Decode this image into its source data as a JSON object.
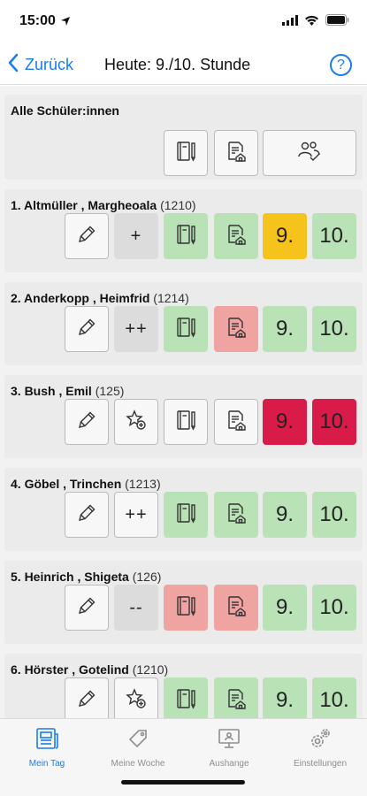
{
  "status_bar": {
    "time": "15:00"
  },
  "nav": {
    "back_label": "Zurück",
    "title": "Heute: 9./10. Stunde",
    "help_label": "?"
  },
  "all_students": {
    "label": "Alle Schüler:innen"
  },
  "students": [
    {
      "label": "1. Altmüller  , Margheoala",
      "id": "(1210)",
      "rating": "+",
      "tiles": {
        "action": "grey",
        "notebook": "green",
        "homework": "green",
        "h9": "yellow",
        "h10": "green"
      },
      "hour9": "9.",
      "hour10": "10."
    },
    {
      "label": "2. Anderkopp  , Heimfrid",
      "id": "(1214)",
      "rating": "++",
      "tiles": {
        "action": "grey",
        "notebook": "green",
        "homework": "red",
        "h9": "green",
        "h10": "green"
      },
      "hour9": "9.",
      "hour10": "10."
    },
    {
      "label": "3. Bush  , Emil",
      "id": "(125)",
      "rating": "star-add",
      "tiles": {
        "action": "plain",
        "notebook": "plain",
        "homework": "plain",
        "h9": "crimson",
        "h10": "crimson"
      },
      "hour9": "9.",
      "hour10": "10."
    },
    {
      "label": "4. Göbel  , Trinchen",
      "id": "(1213)",
      "rating": "++",
      "tiles": {
        "action": "plain",
        "notebook": "green",
        "homework": "green",
        "h9": "green",
        "h10": "green"
      },
      "hour9": "9.",
      "hour10": "10."
    },
    {
      "label": "5. Heinrich  , Shigeta",
      "id": "(126)",
      "rating": "--",
      "tiles": {
        "action": "grey",
        "notebook": "red",
        "homework": "red",
        "h9": "green",
        "h10": "green"
      },
      "hour9": "9.",
      "hour10": "10."
    },
    {
      "label": "6. Hörster  , Gotelind",
      "id": "(1210)",
      "rating": "star-add",
      "tiles": {
        "action": "plain",
        "notebook": "green",
        "homework": "green",
        "h9": "green",
        "h10": "green"
      },
      "hour9": "9.",
      "hour10": "10."
    }
  ],
  "tabs": [
    {
      "label": "Mein Tag",
      "icon": "newspaper-icon",
      "active": true
    },
    {
      "label": "Meine Woche",
      "icon": "tag-icon",
      "active": false
    },
    {
      "label": "Aushange",
      "icon": "monitor-icon",
      "active": false
    },
    {
      "label": "Einstellungen",
      "icon": "gears-icon",
      "active": false
    }
  ],
  "colors": {
    "accent": "#1a7cf2",
    "green": "#b9e3b6",
    "red": "#f0a4a2",
    "yellow": "#f6c21c",
    "crimson": "#d91b4a",
    "grey": "#dcdcdc"
  }
}
